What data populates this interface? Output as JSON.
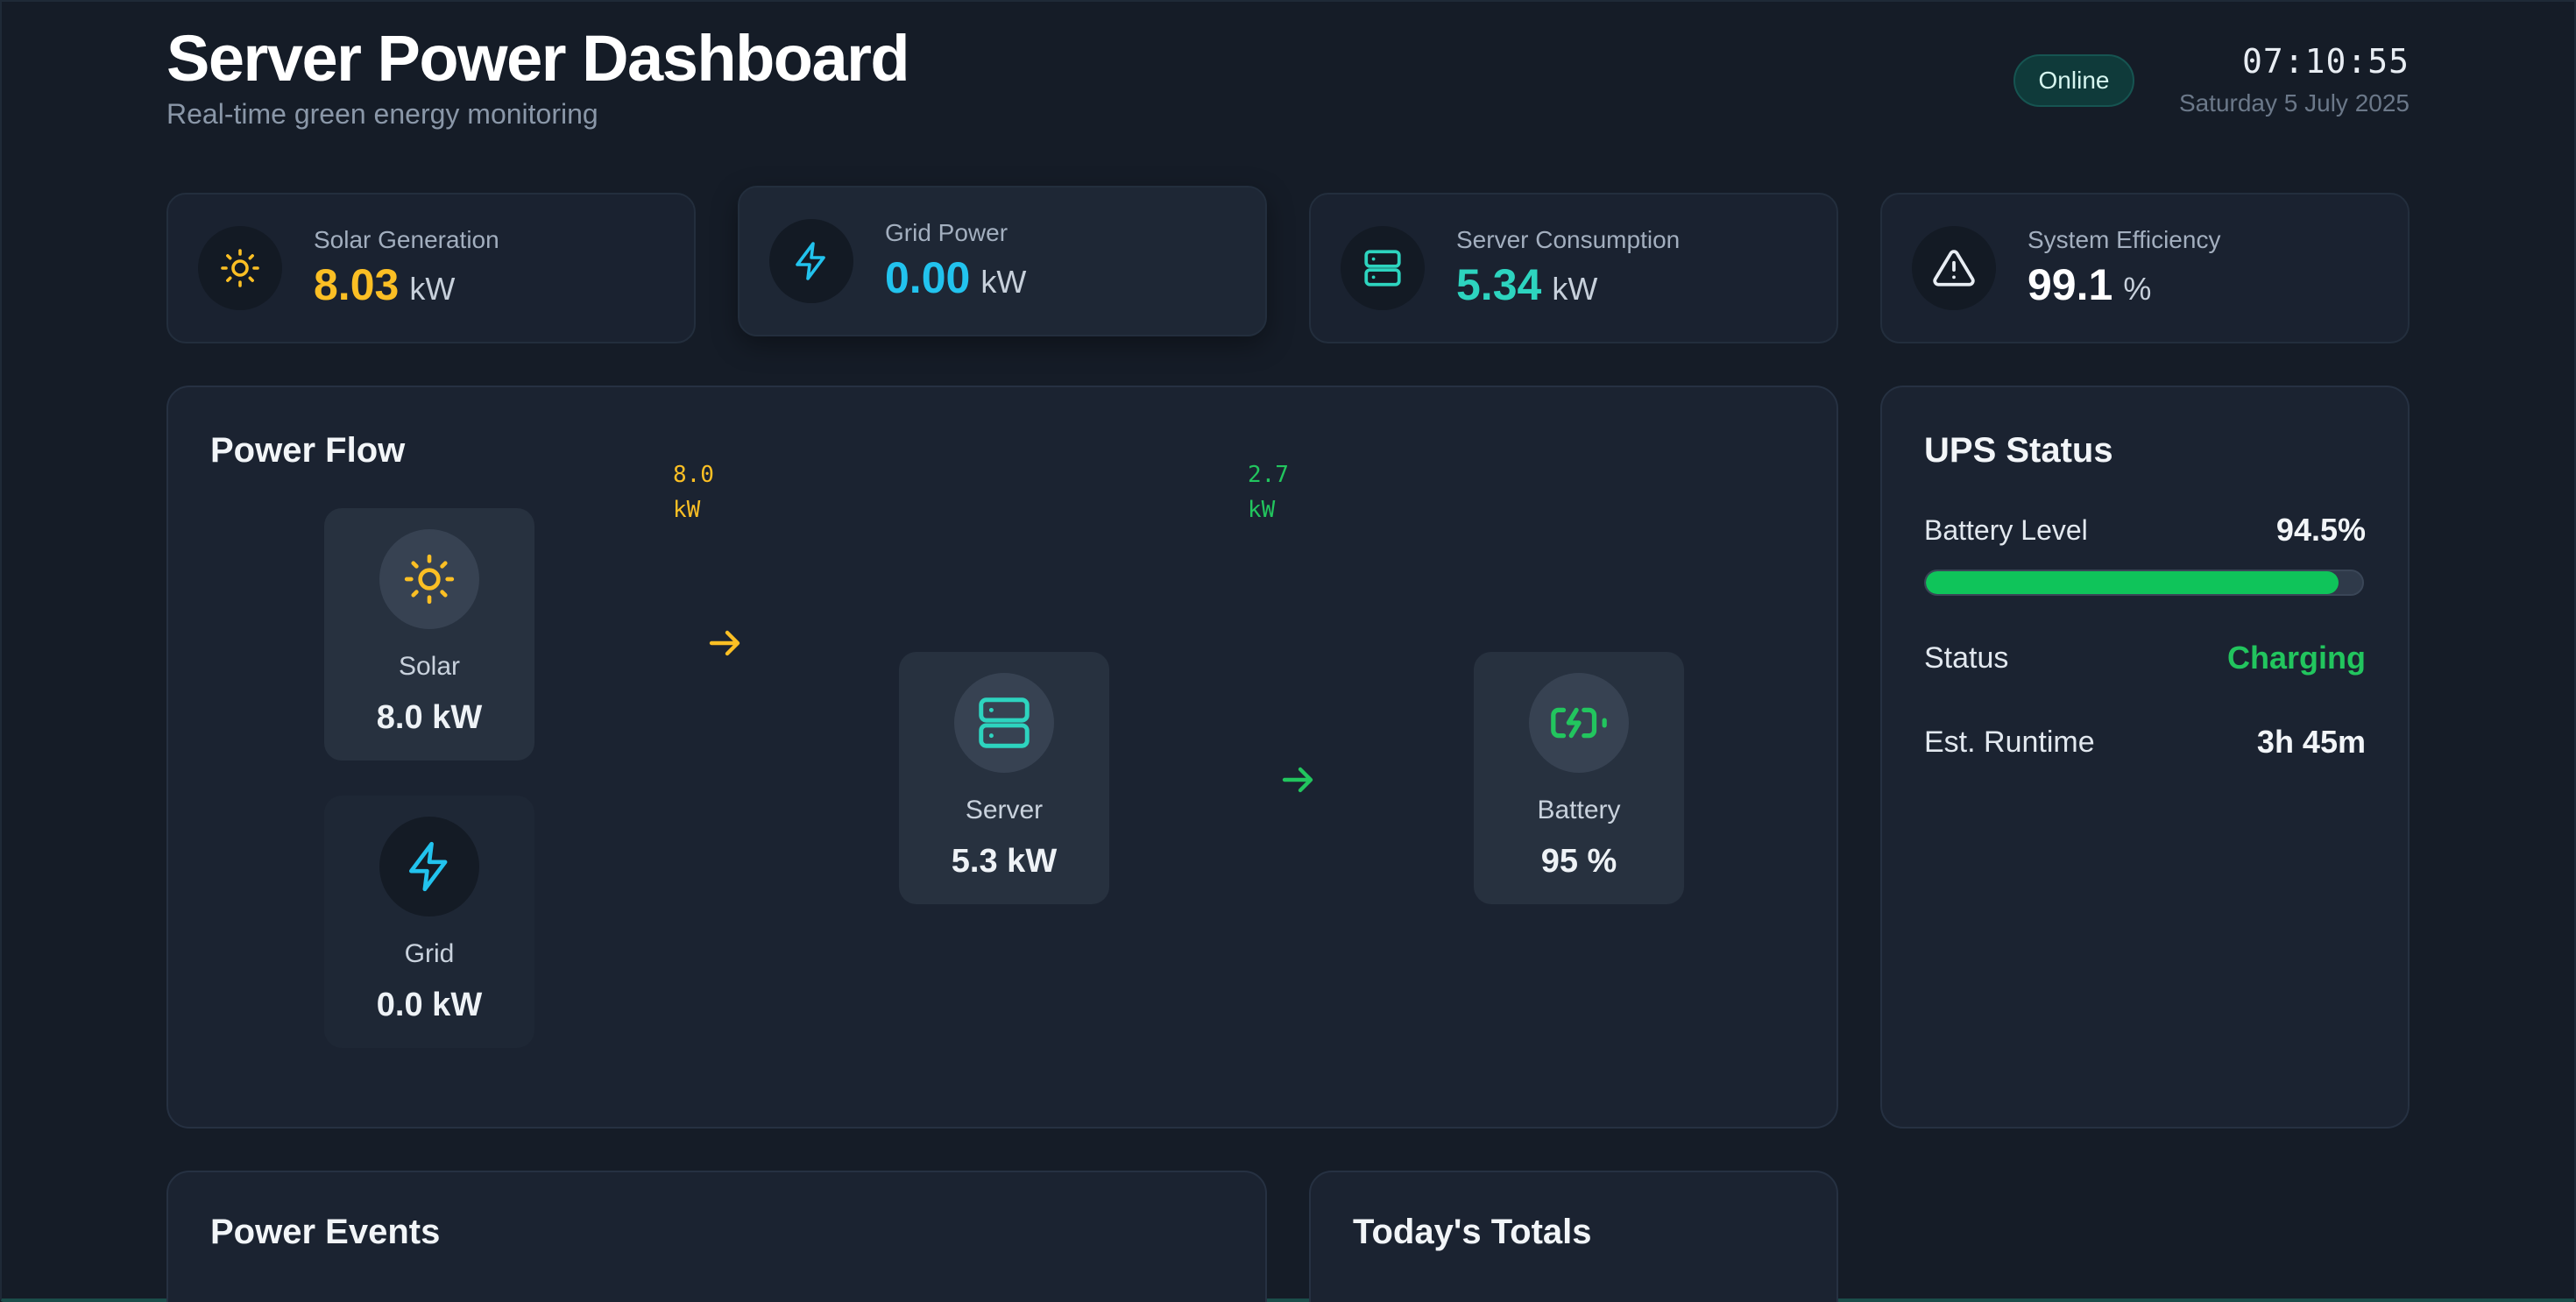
{
  "header": {
    "title": "Server Power Dashboard",
    "subtitle": "Real-time green energy monitoring",
    "status": "Online",
    "time": "07:10:55",
    "date": "Saturday 5 July 2025"
  },
  "stats": [
    {
      "label": "Solar Generation",
      "value": "8.03",
      "unit": "kW",
      "color": "#fbbf24",
      "icon": "sun-icon"
    },
    {
      "label": "Grid Power",
      "value": "0.00",
      "unit": "kW",
      "color": "#22c3ee",
      "icon": "lightning-icon"
    },
    {
      "label": "Server Consumption",
      "value": "5.34",
      "unit": "kW",
      "color": "#2dd4bf",
      "icon": "server-icon"
    },
    {
      "label": "System Efficiency",
      "value": "99.1",
      "unit": "%",
      "color": "#ffffff",
      "icon": "warning-icon"
    }
  ],
  "power_flow": {
    "title": "Power Flow",
    "solar": {
      "label": "Solar",
      "value": "8.0 kW"
    },
    "grid": {
      "label": "Grid",
      "value": "0.0 kW"
    },
    "server": {
      "label": "Server",
      "value": "5.3 kW"
    },
    "battery": {
      "label": "Battery",
      "value": "95 %"
    },
    "solar_flow": {
      "value": "8.0",
      "unit": "kW",
      "color": "#fbbf24"
    },
    "battery_flow": {
      "value": "2.7",
      "unit": "kW",
      "color": "#22c55e"
    }
  },
  "ups": {
    "title": "UPS Status",
    "battery_label": "Battery Level",
    "battery_value": "94.5%",
    "battery_fraction": 0.945,
    "status_label": "Status",
    "status_value": "Charging",
    "status_color": "#22c55e",
    "runtime_label": "Est. Runtime",
    "runtime_value": "3h 45m"
  },
  "sections": {
    "events_title": "Power Events",
    "totals_title": "Today's Totals"
  }
}
